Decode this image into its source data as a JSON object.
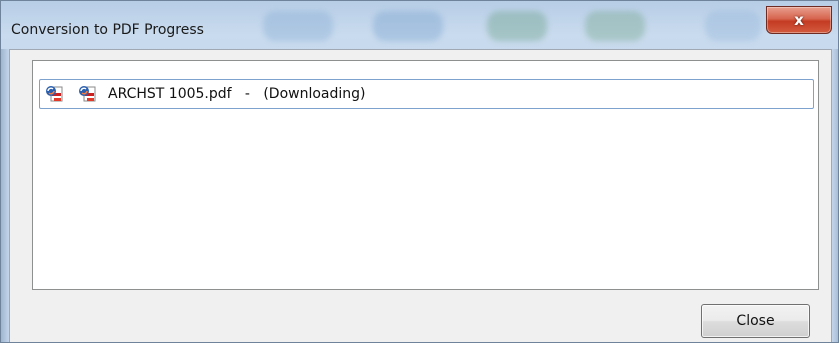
{
  "window": {
    "title": "Conversion to PDF Progress",
    "close_glyph": "x"
  },
  "list": {
    "items": [
      {
        "filename": "ARCHST 1005.pdf",
        "status_text": "ARCHST 1005.pdf   -   (Downloading)",
        "icons": [
          "pdf-convert-icon",
          "pdf-file-icon"
        ]
      }
    ]
  },
  "buttons": {
    "close_label": "Close"
  },
  "colors": {
    "close_button_red": "#c43b23",
    "selection_border": "#7da2ce",
    "pdf_red": "#cc1f1f"
  }
}
